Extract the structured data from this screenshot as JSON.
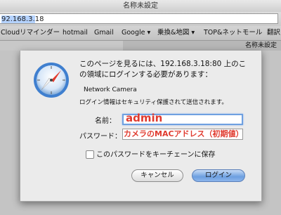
{
  "window": {
    "title": "名称未設定"
  },
  "address_bar": {
    "url_selected": "92.168.3.",
    "url_rest": "18"
  },
  "bookmarks": [
    {
      "label": "Cloudリマインダー"
    },
    {
      "label": "hotmail"
    },
    {
      "label": "Gmail"
    },
    {
      "label": "Google ▾"
    },
    {
      "label": "乗換&地図 ▾"
    },
    {
      "label": "TOP&ネットモール"
    },
    {
      "label": "翻訳"
    }
  ],
  "tabs": {
    "other_tab_title": "名称未設定"
  },
  "auth_dialog": {
    "message_line1": "このページを見るには、192.168.3.18:80 上のこ",
    "message_line2": "の領域にログインする必要があります：",
    "realm": "Network Camera",
    "security_note": "ログイン情報はセキュリティ保護されて送信されます。",
    "name_label": "名前：",
    "name_value": "admin",
    "password_label": "パスワード：",
    "password_annotation": "カメラのMACアドレス（初期値）",
    "remember_label": "このパスワードをキーチェーンに保存",
    "cancel_label": "キャンセル",
    "login_label": "ログイン"
  },
  "colors": {
    "annotation_red": "#e03a2e",
    "focus_blue": "#6fa0e0",
    "primary_button": "#6c9fe0"
  }
}
